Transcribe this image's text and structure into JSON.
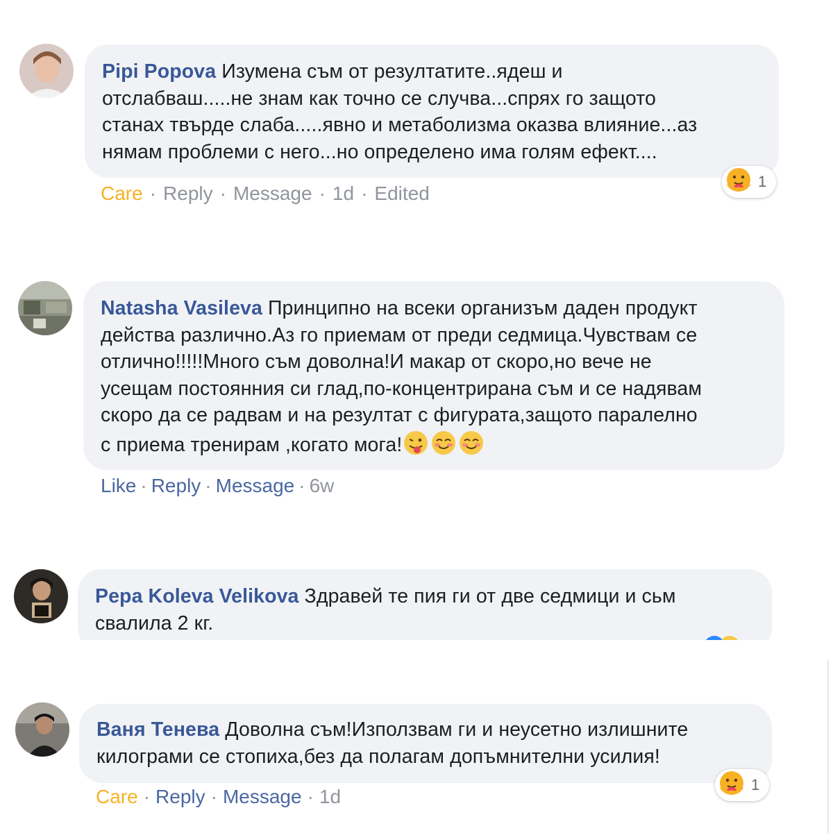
{
  "comments": [
    {
      "author": "Pipi Popova",
      "text_lines": [
        "Изумена съм от резултатите..ядеш и",
        "отслабваш.....не знам как точно се случва...спрях го защото",
        "станах твърде слаба.....явно и метаболизма оказва влияние...аз",
        "нямам проблеми с него...но определено има голям ефект...."
      ],
      "actions": {
        "reaction": "Care",
        "reply": "Reply",
        "message": "Message",
        "time": "1d",
        "edited": "Edited"
      },
      "reaction_count": "1",
      "reaction_icon": "care-emoji-icon"
    },
    {
      "author": "Natasha Vasileva",
      "text_lines": [
        "Принципно на всеки организъм даден продукт",
        "действа различно.Аз го приемам от преди седмица.Чувствам се",
        "отлично!!!!!Много съм доволна!И макар от скоро,но вече не",
        "усещам постоянния си глад,по-концентрирана съм и се надявам",
        "скоро да се радвам и на резултат с фигурата,защото паралелно",
        "с приема тренирам ,когато мога!"
      ],
      "emojis": [
        "tongue-wink-emoji-icon",
        "smiling-blush-emoji-icon",
        "smiling-blush-emoji-icon"
      ],
      "actions": {
        "reaction": "Like",
        "reply": "Reply",
        "message": "Message",
        "time": "6w"
      }
    },
    {
      "author": "Pepa Koleva Velikova",
      "text_lines": [
        "Здравей те пия ги от две седмици и сьм",
        "свалила 2 кг."
      ]
    },
    {
      "author": "Ваня Тенева",
      "text_lines": [
        "Доволна съм!Използвам ги и неусетно излишните",
        "килограми се стопиха,без да полагам допъмнителни усилия!"
      ],
      "actions": {
        "reaction": "Care",
        "reply": "Reply",
        "message": "Message",
        "time": "1d"
      },
      "reaction_count": "1",
      "reaction_icon": "care-emoji-icon"
    }
  ],
  "colors": {
    "bubble": "#f1f2f5",
    "author": "#385898",
    "link": "#4b67a1",
    "meta": "#90949c",
    "care": "#f7b125"
  }
}
